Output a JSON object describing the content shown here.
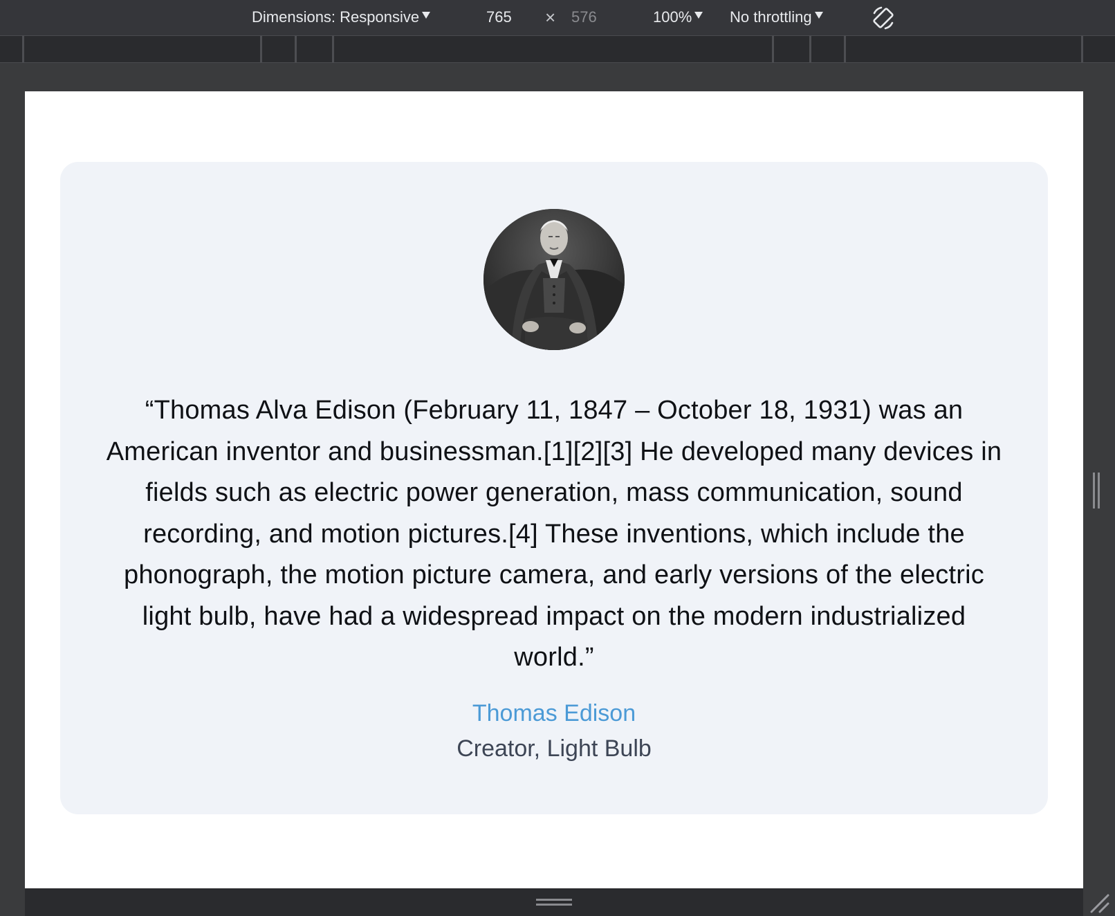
{
  "toolbar": {
    "dimensions_label": "Dimensions: Responsive",
    "width_value": "765",
    "times_symbol": "×",
    "height_value": "576",
    "zoom_label": "100%",
    "throttling_label": "No throttling",
    "rotate_icon": "rotate-icon"
  },
  "testimonial": {
    "avatar_icon": "portrait-photo",
    "quote": "“Thomas Alva Edison (February 11, 1847 – October 18, 1931) was an American inventor and businessman.[1][2][3] He developed many devices in fields such as electric power generation, mass communication, sound recording, and motion pictures.[4] These inventions, which include the phonograph, the motion picture camera, and early versions of the electric light bulb, have had a widespread impact on the modern industrialized world.”",
    "author_name": "Thomas Edison",
    "author_role": "Creator, Light Bulb"
  },
  "colors": {
    "card_bg": "#f0f3f8",
    "author_name": "#4b9ad6",
    "author_role": "#3d4555",
    "devtools_bg": "#35363a"
  }
}
